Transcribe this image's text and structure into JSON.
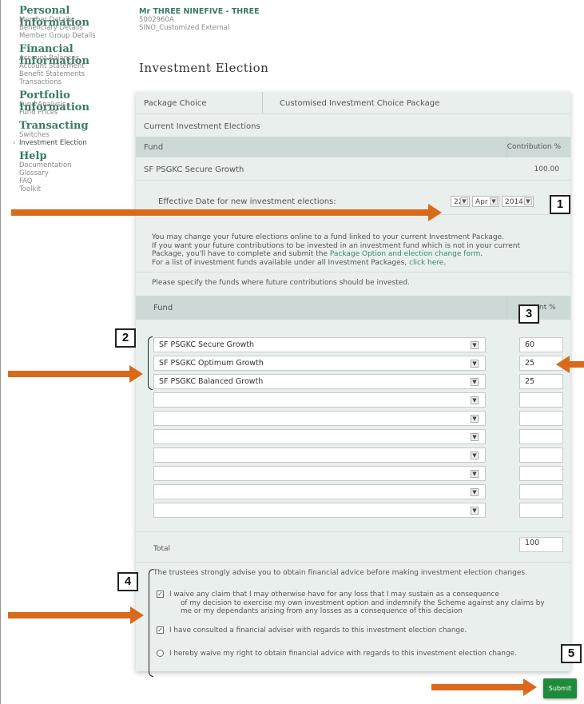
{
  "member": {
    "name": "Mr THREE NINEFIVE - THREE",
    "number": "5002960A",
    "plan": "SINO_Customized External"
  },
  "sidebar": {
    "sections": [
      {
        "title": "Personal Information",
        "items": [
          "Member Details",
          "Beneficiary Details",
          "Member Group Details"
        ]
      },
      {
        "title": "Financial Information",
        "items": [
          "Account Balances",
          "Account Statement",
          "Benefit Statements",
          "Transactions"
        ]
      },
      {
        "title": "Portfolio Information",
        "items": [
          "Fund Analysis",
          "Fund Prices"
        ]
      },
      {
        "title": "Transacting",
        "items": [
          "Switches",
          "Investment Election"
        ]
      },
      {
        "title": "Help",
        "items": [
          "Documentation",
          "Glossary",
          "FAQ",
          "Toolkit"
        ]
      }
    ],
    "active_item": "Investment Election"
  },
  "page_title": "Investment Election",
  "package": {
    "label": "Package Choice",
    "value": "Customised Investment Choice Package"
  },
  "current": {
    "heading": "Current Investment Elections",
    "col_fund": "Fund",
    "col_contribution": "Contribution %",
    "fund": "SF PSGKC Secure Growth",
    "value": "100.00"
  },
  "effective": {
    "label": "Effective Date for new investment elections:",
    "day": "22",
    "month": "Apr",
    "year": "2014"
  },
  "info": {
    "line1": "You may change your future elections online to a fund linked to your current Investment Package.",
    "line2": "If you want your future contributions to be invested in an investment fund which is not in your current",
    "line3_prefix": "Package, you'll have to complete and submit the ",
    "line3_link": "Package Option and election change form",
    "line3_suffix": ".",
    "line4_prefix": "For a list of investment funds available under all Investment Packages, ",
    "line4_link": "click here",
    "line4_suffix": ".",
    "specify": "Please specify the funds where future contributions should be invested."
  },
  "future": {
    "col_fund": "Fund",
    "col_percent": "nt %",
    "rows": [
      {
        "fund": "SF PSGKC Secure Growth",
        "pct": "60"
      },
      {
        "fund": "SF PSGKC Optimum Growth",
        "pct": "25"
      },
      {
        "fund": "SF PSGKC Balanced Growth",
        "pct": "25"
      },
      {
        "fund": "",
        "pct": ""
      },
      {
        "fund": "",
        "pct": ""
      },
      {
        "fund": "",
        "pct": ""
      },
      {
        "fund": "",
        "pct": ""
      },
      {
        "fund": "",
        "pct": ""
      },
      {
        "fund": "",
        "pct": ""
      },
      {
        "fund": "",
        "pct": ""
      }
    ],
    "total_label": "Total",
    "total_value": "100"
  },
  "advice": {
    "intro": "The trustees strongly advise you to obtain financial advice before making investment election changes.",
    "waive_claim_line1": "I waive any claim that I may otherwise have for any loss that I may sustain as a consequence",
    "waive_claim_line2": "of my decision to exercise my own investment option and indemnify the Scheme against any claims by",
    "waive_claim_line3": "me or my dependants arising from any losses as a consequence of this decision",
    "consulted": "I have consulted a financial adviser with regards to this investment election change.",
    "waive_advice": "I hereby waive my right to obtain financial advice with regards to this investment election change."
  },
  "submit_label": "Submit",
  "annotations": [
    "1",
    "2",
    "3",
    "4",
    "5"
  ],
  "colors": {
    "accent_green": "#3a7a62",
    "arrow_orange": "#d96a1c",
    "submit_green": "#1f8a3a",
    "panel_bg": "#e9efec"
  }
}
